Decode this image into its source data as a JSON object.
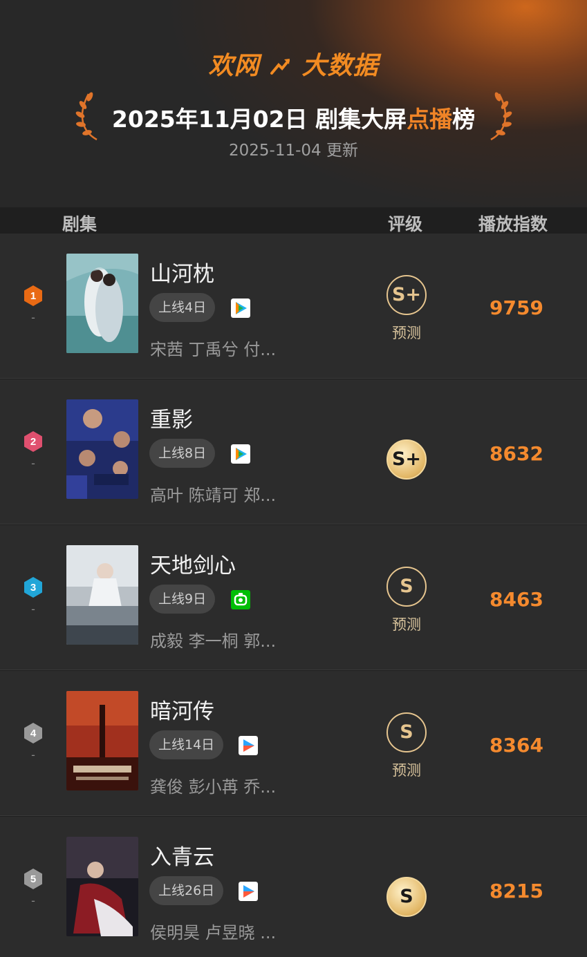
{
  "header": {
    "brand_left": "欢网",
    "brand_right": "大数据",
    "title_main": "2025年11月02日 剧集大屏",
    "title_highlight": "点播",
    "title_tail": "榜",
    "update": "2025-11-04 更新",
    "accent_color": "#f08427"
  },
  "columns": {
    "series": "剧集",
    "grade": "评级",
    "index": "播放指数"
  },
  "rows": [
    {
      "rank": "1",
      "name": "山河枕",
      "days": "上线4日",
      "platform": "tencent-video-icon",
      "cast": "宋茜 丁禹兮 付...",
      "grade": "S+",
      "grade_style": "outline",
      "grade_note": "预测",
      "score": "9759",
      "rank_color": "#e96a14"
    },
    {
      "rank": "2",
      "name": "重影",
      "days": "上线8日",
      "platform": "tencent-video-icon",
      "cast": "高叶 陈靖可 郑...",
      "grade": "S+",
      "grade_style": "filled",
      "grade_note": "",
      "score": "8632",
      "rank_color": "#e0506f"
    },
    {
      "rank": "3",
      "name": "天地剑心",
      "days": "上线9日",
      "platform": "iqiyi-icon",
      "cast": "成毅 李一桐 郭...",
      "grade": "S",
      "grade_style": "outline",
      "grade_note": "预测",
      "score": "8463",
      "rank_color": "#21a6d8"
    },
    {
      "rank": "4",
      "name": "暗河传",
      "days": "上线14日",
      "platform": "youku-icon",
      "cast": "龚俊 彭小苒 乔...",
      "grade": "S",
      "grade_style": "outline",
      "grade_note": "预测",
      "score": "8364",
      "rank_color": "#9a9a9a"
    },
    {
      "rank": "5",
      "name": "入青云",
      "days": "上线26日",
      "platform": "youku-icon",
      "cast": "侯明昊 卢昱晓 ...",
      "grade": "S",
      "grade_style": "filled",
      "grade_note": "",
      "score": "8215",
      "rank_color": "#9a9a9a"
    }
  ]
}
